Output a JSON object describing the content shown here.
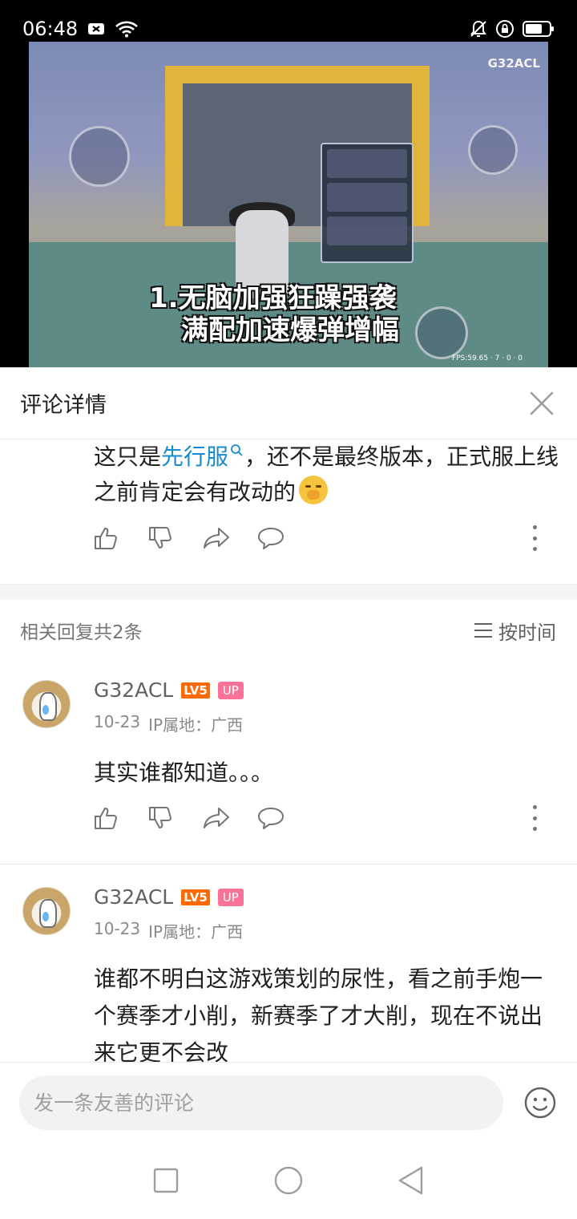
{
  "status_bar": {
    "time": "06:48"
  },
  "video": {
    "watermark": "G32ACL",
    "subtitle_line1": "1.无脑加强狂躁强袭",
    "subtitle_line2": "满配加速爆弹增幅",
    "fps_text": "FPS:59.65 · 7 · 0 · 0"
  },
  "header": {
    "title": "评论详情"
  },
  "root_comment": {
    "text_before": "这只是",
    "link_text": "先行服",
    "text_after": "，还不是最终版本，正式服上线之前肯定会有改动的"
  },
  "replies": {
    "count_label": "相关回复共2条",
    "sort_label": "按时间",
    "items": [
      {
        "username": "G32ACL",
        "level": "LV5",
        "up_badge": "UP",
        "date": "10-23",
        "ip": "IP属地：广西",
        "text": "其实谁都知道。。。"
      },
      {
        "username": "G32ACL",
        "level": "LV5",
        "up_badge": "UP",
        "date": "10-23",
        "ip": "IP属地：广西",
        "text": "谁都不明白这游戏策划的尿性，看之前手炮一个赛季才小削，新赛季了才大削，现在不说出来它更不会改"
      }
    ]
  },
  "input": {
    "placeholder": "发一条友善的评论"
  },
  "colors": {
    "link": "#178bcf",
    "up_badge": "#fb7299",
    "level_badge": "#ff6a00"
  }
}
